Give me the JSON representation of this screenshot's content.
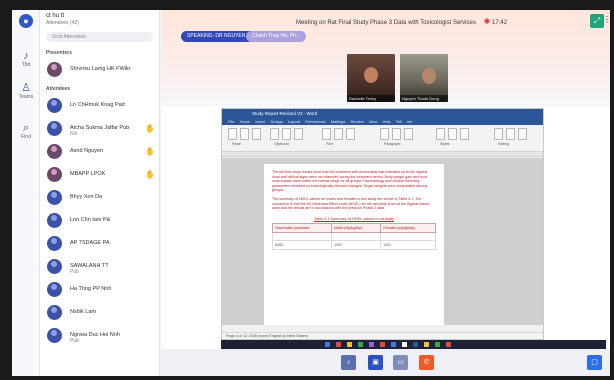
{
  "rail": {
    "items": [
      {
        "icon": "activity-icon",
        "glyph": "♪",
        "label": "Tbd"
      },
      {
        "icon": "people-icon",
        "glyph": "♙",
        "label": "Teams"
      },
      {
        "icon": "search-icon",
        "glyph": "⌕",
        "label": "Find"
      }
    ]
  },
  "panel": {
    "title": "ct hu tt",
    "subtitle": "Attendees (42)",
    "search_placeholder": "Srch Attendees",
    "sections": [
      {
        "label": "Presenters",
        "people": [
          {
            "name": "Shrvnku Lamg HK FWikr",
            "sub": "",
            "hand": false,
            "pic": true
          }
        ]
      },
      {
        "label": "Attendees",
        "people": [
          {
            "name": "Ln ChHmuk Knag Pad",
            "sub": "",
            "hand": false,
            "pic": false
          },
          {
            "name": "Atcha Sukma Jaffar Pub",
            "sub": "Nis",
            "hand": true,
            "pic": false
          },
          {
            "name": "Asnd Nguyen",
            "sub": "",
            "hand": true,
            "pic": true
          },
          {
            "name": "MBAPP LPOK",
            "sub": "",
            "hand": true,
            "pic": true
          },
          {
            "name": "Bhyy Xon Da",
            "sub": "",
            "hand": false,
            "pic": false
          },
          {
            "name": "Lnn Chn tam P&",
            "sub": "",
            "hand": false,
            "pic": false
          },
          {
            "name": "AP 7SDAGE PA",
            "sub": "",
            "hand": false,
            "pic": false
          },
          {
            "name": "SAWALANH TT",
            "sub": "Pub",
            "hand": false,
            "pic": false
          },
          {
            "name": "Ha Thng PP Nnh",
            "sub": "",
            "hand": false,
            "pic": false
          },
          {
            "name": "Nsbik Lam",
            "sub": "",
            "hand": false,
            "pic": false
          },
          {
            "name": "Ngnwa Duc Hoi Nnh",
            "sub": "Pub",
            "hand": false,
            "pic": false
          }
        ]
      }
    ]
  },
  "meeting": {
    "title": "Meeting on Rat Final Study Phase 3 Data with Toxicologist Services",
    "timer": "17:42",
    "chips": [
      "SPEAKING: DR NGUYEN TRIE",
      "Chanh Thuy Ha, Ph..."
    ],
    "videos": [
      {
        "caption": "Rachelle Tenny"
      },
      {
        "caption": "Nguyen Thanh Dung"
      }
    ]
  },
  "word": {
    "window_title": "Study Report Revised V2 - Word",
    "tabs": [
      "File",
      "Home",
      "Insert",
      "Design",
      "Layout",
      "References",
      "Mailings",
      "Review",
      "View",
      "Help",
      "Tell me"
    ],
    "ribbon_labels": [
      "Paste",
      "Clipboard",
      "Font",
      "Paragraph",
      "Styles",
      "Editing"
    ],
    "paragraphs": [
      "The rat final study results show that the treatment with Ameloxistat was tolerated up to the highest dose and clinical signs were not observed during the treatment period. Body weight gain and food consumption were within the normal range for all groups. Haematology and clinical chemistry parameters revealed no toxicologically relevant changes. Organ weights were comparable among groups.",
      "The summary of NOEL values for males and females in this study are shown in Table 5.1. The conclusion is that the No Observed Effect Level (NOEL) for the rat study is set at the highest tested dose and the results are in accordance with the previous Phase 2 data."
    ],
    "table_title": "Table 5.1 Summary of NOEL values in rat study",
    "table_headers": [
      "Observation parameter",
      "Males (mg/kg/day)",
      "Females (mg/kg/day)"
    ],
    "table_rows": [
      [
        "",
        "",
        ""
      ],
      [
        "NOEL",
        "1000",
        "1000"
      ]
    ],
    "status_text": "Page 4 of 12   2345 words   English (United States)"
  },
  "colors": {
    "accent": "#3148b8",
    "end_call": "#ee5a24",
    "word_blue": "#2b579a",
    "doc_red": "#b4232a"
  }
}
